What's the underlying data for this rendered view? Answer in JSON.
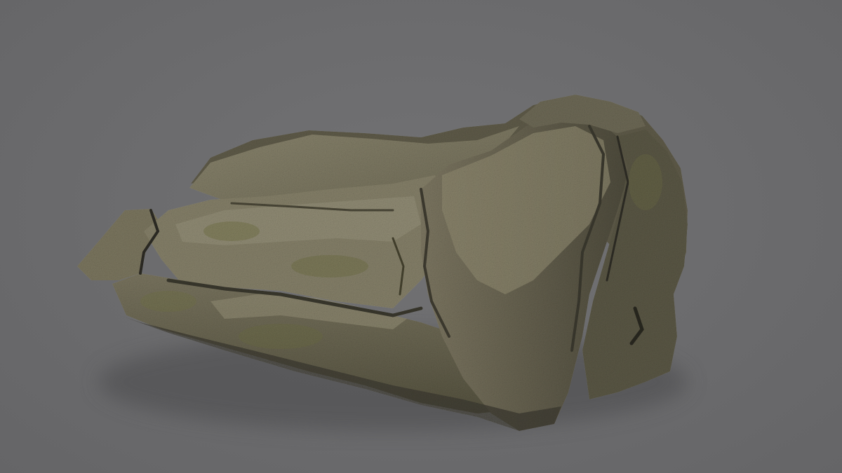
{
  "viewport": {
    "background_color": "#6b6b6d",
    "subject": "rock-model"
  },
  "palette": {
    "rock_light": "#8e8873",
    "rock_mid": "#6e6a55",
    "rock_dark": "#4a4736",
    "rock_shadow": "#33312a",
    "moss": "#6f7048",
    "ground_shadow": "#58585a"
  }
}
